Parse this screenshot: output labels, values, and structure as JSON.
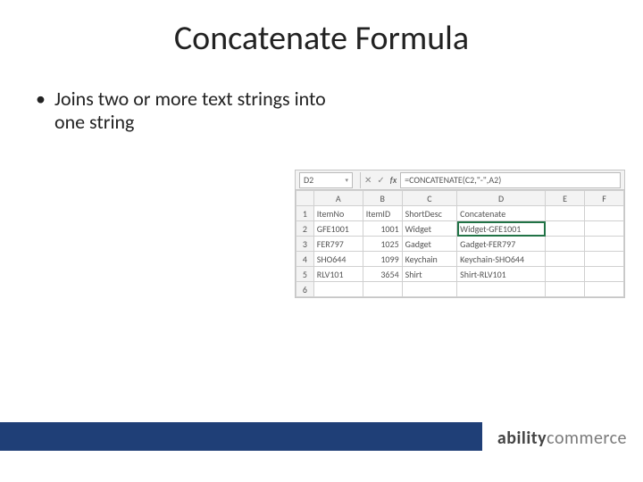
{
  "title": "Concatenate Formula",
  "bullet": "Joins two or more text strings into one string",
  "excel": {
    "namebox": "D2",
    "formula": "=CONCATENATE(C2,\"-\",A2)",
    "cols": [
      "A",
      "B",
      "C",
      "D",
      "E",
      "F"
    ],
    "headers": [
      "ItemNo",
      "ItemID",
      "ShortDesc",
      "Concatenate",
      "",
      ""
    ],
    "rows": [
      {
        "n": "1",
        "c": [
          "ItemNo",
          "ItemID",
          "ShortDesc",
          "Concatenate",
          "",
          ""
        ]
      },
      {
        "n": "2",
        "c": [
          "GFE1001",
          "1001",
          "Widget",
          "Widget-GFE1001",
          "",
          ""
        ],
        "sel": 3
      },
      {
        "n": "3",
        "c": [
          "FER797",
          "1025",
          "Gadget",
          "Gadget-FER797",
          "",
          ""
        ]
      },
      {
        "n": "4",
        "c": [
          "SHO644",
          "1099",
          "Keychain",
          "Keychain-SHO644",
          "",
          ""
        ]
      },
      {
        "n": "5",
        "c": [
          "RLV101",
          "3654",
          "Shirt",
          "Shirt-RLV101",
          "",
          ""
        ]
      },
      {
        "n": "6",
        "c": [
          "",
          "",
          "",
          "",
          "",
          ""
        ]
      }
    ]
  },
  "logo": {
    "strong": "ability",
    "light": "commerce"
  }
}
